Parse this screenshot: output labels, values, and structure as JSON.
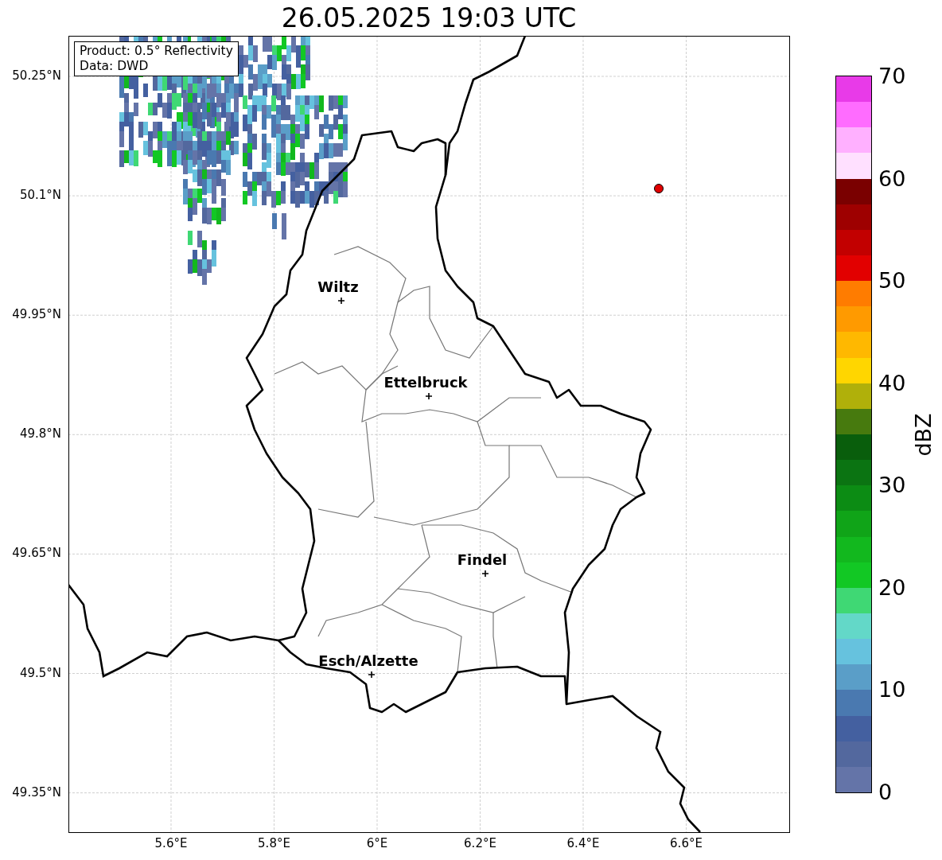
{
  "title": "26.05.2025 19:03 UTC",
  "legend": [
    "Product: 0.5° Reflectivity",
    "Data: DWD"
  ],
  "map": {
    "y_ticks": [
      "50.25°N",
      "50.1°N",
      "49.95°N",
      "49.8°N",
      "49.65°N",
      "49.5°N",
      "49.35°N"
    ],
    "x_ticks": [
      "5.6°E",
      "5.8°E",
      "6°E",
      "6.2°E",
      "6.4°E",
      "6.6°E"
    ],
    "cities": [
      {
        "name": "Wiltz"
      },
      {
        "name": "Ettelbruck"
      },
      {
        "name": "Findel"
      },
      {
        "name": "Esch/Alzette"
      }
    ]
  },
  "colorbar": {
    "label": "dBZ",
    "ticks": [
      "70",
      "60",
      "50",
      "40",
      "30",
      "20",
      "10",
      "0"
    ],
    "bins": [
      {
        "color": "#e83ae8"
      },
      {
        "color": "#ff6cff"
      },
      {
        "color": "#ffb0ff"
      },
      {
        "color": "#ffe0ff"
      },
      {
        "color": "#7a0000"
      },
      {
        "color": "#9e0000"
      },
      {
        "color": "#c20000"
      },
      {
        "color": "#e20000"
      },
      {
        "color": "#ff7c00"
      },
      {
        "color": "#ff9a00"
      },
      {
        "color": "#ffb800"
      },
      {
        "color": "#ffd600"
      },
      {
        "color": "#b0b00a"
      },
      {
        "color": "#477a0e"
      },
      {
        "color": "#095e0c"
      },
      {
        "color": "#0b7412"
      },
      {
        "color": "#0c8c14"
      },
      {
        "color": "#10a418"
      },
      {
        "color": "#12b81e"
      },
      {
        "color": "#12c824"
      },
      {
        "color": "#3fd874"
      },
      {
        "color": "#63d8c8"
      },
      {
        "color": "#66c2de"
      },
      {
        "color": "#5a9ec8"
      },
      {
        "color": "#4a79b0"
      },
      {
        "color": "#4460a0"
      },
      {
        "color": "#53689e"
      },
      {
        "color": "#6474a8"
      }
    ]
  }
}
